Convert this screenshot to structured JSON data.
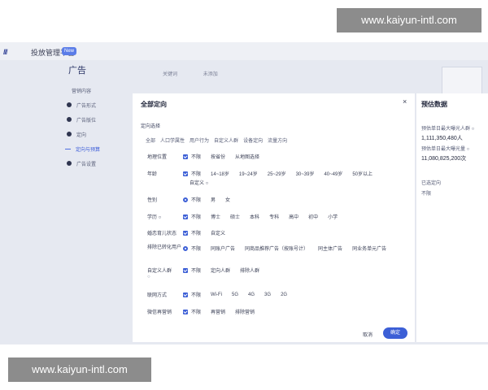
{
  "watermarks": {
    "top": "www.kaiyun-intl.com",
    "bottom": "www.kaiyun-intl.com"
  },
  "topbar": {
    "logo": "///",
    "platform_title": "投放管理平台",
    "badge": "New"
  },
  "sidebar": {
    "title": "广告",
    "items": [
      {
        "label": "营销内容",
        "marker": "none"
      },
      {
        "label": "广告形式",
        "marker": "dot"
      },
      {
        "label": "广告版位",
        "marker": "dot"
      },
      {
        "label": "定向",
        "marker": "dot"
      },
      {
        "label": "定向与预算",
        "marker": "dash",
        "active": true
      },
      {
        "label": "广告设置",
        "marker": "dot"
      }
    ]
  },
  "background": {
    "text1": "关键词",
    "text2": "未添加",
    "right_box": ""
  },
  "modal": {
    "title": "全部定向",
    "close": "×",
    "section_label": "定向选择",
    "type_tabs": [
      "全部",
      "人口学属性",
      "用户行为",
      "自定义人群",
      "设备定向",
      "流量方向"
    ],
    "rows": [
      {
        "label": "地理位置",
        "options": [
          {
            "kind": "check",
            "text": "不限"
          },
          {
            "kind": "none",
            "text": "按省份"
          },
          {
            "kind": "none",
            "text": "从地图选择"
          }
        ]
      },
      {
        "label": "年龄",
        "options": [
          {
            "kind": "check",
            "text": "不限"
          },
          {
            "kind": "none",
            "text": "14~18岁"
          },
          {
            "kind": "none",
            "text": "19~24岁"
          },
          {
            "kind": "none",
            "text": "25~29岁"
          },
          {
            "kind": "none",
            "text": "30~39岁"
          },
          {
            "kind": "none",
            "text": "40~49岁"
          },
          {
            "kind": "none",
            "text": "50岁以上"
          }
        ]
      },
      {
        "label": "性别",
        "options": [
          {
            "kind": "radio",
            "text": "不限"
          },
          {
            "kind": "none",
            "text": "男"
          },
          {
            "kind": "none",
            "text": "女"
          }
        ]
      },
      {
        "label": "学历 ○",
        "options": [
          {
            "kind": "check",
            "text": "不限"
          },
          {
            "kind": "none",
            "text": "博士"
          },
          {
            "kind": "none",
            "text": "硕士"
          },
          {
            "kind": "none",
            "text": "本科"
          },
          {
            "kind": "none",
            "text": "专科"
          },
          {
            "kind": "none",
            "text": "高中"
          },
          {
            "kind": "none",
            "text": "初中"
          },
          {
            "kind": "none",
            "text": "小学"
          }
        ]
      },
      {
        "label": "婚恋育儿状态",
        "options": [
          {
            "kind": "check",
            "text": "不限"
          },
          {
            "kind": "none",
            "text": "自定义"
          }
        ]
      },
      {
        "label": "排除已转化用户",
        "options": [
          {
            "kind": "radio",
            "text": "不限"
          },
          {
            "kind": "none",
            "text": "同账户广告"
          },
          {
            "kind": "none",
            "text": "同商品推荐广告（按账号计）"
          },
          {
            "kind": "none",
            "text": "同主体广告"
          },
          {
            "kind": "none",
            "text": "同业务单元广告"
          }
        ]
      },
      {
        "label": "自定义人群",
        "options": [
          {
            "kind": "check",
            "text": "不限"
          },
          {
            "kind": "none",
            "text": "定向人群"
          },
          {
            "kind": "none",
            "text": "排除人群"
          }
        ]
      },
      {
        "label": "联网方式",
        "options": [
          {
            "kind": "check",
            "text": "不限"
          },
          {
            "kind": "none",
            "text": "Wi-Fi"
          },
          {
            "kind": "none",
            "text": "5G"
          },
          {
            "kind": "none",
            "text": "4G"
          },
          {
            "kind": "none",
            "text": "3G"
          },
          {
            "kind": "none",
            "text": "2G"
          }
        ]
      },
      {
        "label": "微信再营销",
        "options": [
          {
            "kind": "check",
            "text": "不限"
          },
          {
            "kind": "none",
            "text": "再营销"
          },
          {
            "kind": "none",
            "text": "排除营销"
          }
        ]
      }
    ],
    "age_extra": "自定义 ○",
    "custom_help": "○",
    "cancel": "取消",
    "ok": "确定"
  },
  "estimate_panel": {
    "title": "预估数据",
    "line1": "预估单日最大曝光人群 ○",
    "num1": "1,111,350,480人",
    "line2": "预估单日最大曝光量 ○",
    "num2": "11,080,825,200次",
    "line3": "已选定向",
    "line4": "不限"
  },
  "colors": {
    "accent": "#3c5fd6",
    "background": "#e6e9f1",
    "watermark": "#8c8c8c"
  }
}
